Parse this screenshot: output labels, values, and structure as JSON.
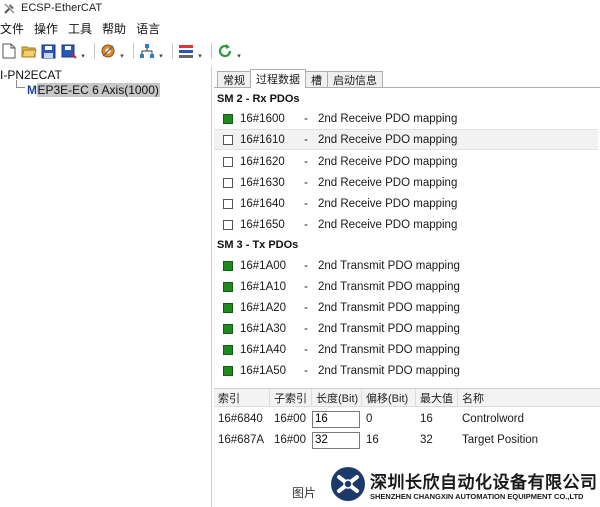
{
  "window": {
    "title": "ECSP-EtherCAT",
    "app_icon": "wrench-screwdriver-icon"
  },
  "menu": [
    "文件",
    "操作",
    "工具",
    "帮助",
    "语言"
  ],
  "toolbar": [
    {
      "icon": "new-file-icon",
      "dropdown": false
    },
    {
      "icon": "open-folder-icon",
      "dropdown": false
    },
    {
      "icon": "save-icon",
      "dropdown": false
    },
    {
      "icon": "save-as-icon",
      "dropdown": true
    },
    {
      "icon": "settings-tool-icon",
      "dropdown": true
    },
    {
      "icon": "network-scan-icon",
      "dropdown": true
    },
    {
      "icon": "device-config-icon",
      "dropdown": true
    },
    {
      "icon": "refresh-icon",
      "dropdown": true
    }
  ],
  "tree": {
    "root": "I-PN2ECAT",
    "child_icon": "M",
    "child": "EP3E-EC 6 Axis(1000)"
  },
  "tabs": [
    {
      "label": "常规",
      "active": false
    },
    {
      "label": "过程数据",
      "active": true
    },
    {
      "label": "槽",
      "active": false
    },
    {
      "label": "启动信息",
      "active": false
    }
  ],
  "rx": {
    "title": "SM 2 - Rx PDOs",
    "items": [
      {
        "index": "16#1600",
        "name": "2nd Receive PDO mapping",
        "checked": true
      },
      {
        "index": "16#1610",
        "name": "2nd Receive PDO mapping",
        "checked": false
      },
      {
        "index": "16#1620",
        "name": "2nd Receive PDO mapping",
        "checked": false
      },
      {
        "index": "16#1630",
        "name": "2nd Receive PDO mapping",
        "checked": false
      },
      {
        "index": "16#1640",
        "name": "2nd Receive PDO mapping",
        "checked": false
      },
      {
        "index": "16#1650",
        "name": "2nd Receive PDO mapping",
        "checked": false
      }
    ]
  },
  "tx": {
    "title": "SM 3 - Tx PDOs",
    "items": [
      {
        "index": "16#1A00",
        "name": "2nd Transmit PDO mapping",
        "checked": true
      },
      {
        "index": "16#1A10",
        "name": "2nd Transmit PDO mapping",
        "checked": true
      },
      {
        "index": "16#1A20",
        "name": "2nd Transmit PDO mapping",
        "checked": true
      },
      {
        "index": "16#1A30",
        "name": "2nd Transmit PDO mapping",
        "checked": true
      },
      {
        "index": "16#1A40",
        "name": "2nd Transmit PDO mapping",
        "checked": true
      },
      {
        "index": "16#1A50",
        "name": "2nd Transmit PDO mapping",
        "checked": true
      }
    ]
  },
  "dash": "-",
  "table": {
    "headers": [
      "索引",
      "子索引",
      "长度(Bit)",
      "偏移(Bit)",
      "最大值",
      "名称"
    ],
    "rows": [
      {
        "index": "16#6840",
        "subindex": "16#00",
        "length": "16",
        "offset": "0",
        "max": "16",
        "name": "Controlword"
      },
      {
        "index": "16#687A",
        "subindex": "16#00",
        "length": "32",
        "offset": "16",
        "max": "32",
        "name": "Target Position"
      }
    ]
  },
  "watermark": {
    "caption": "图片",
    "company_cn": "深圳长欣自动化设备有限公司",
    "company_en": "SHENZHEN CHANGXIN AUTOMATION EQUIPMENT CO.,LTD",
    "logo_color": "#1b3a6b"
  },
  "colors": {
    "checked": "#1f8a1f",
    "selection": "#c7c7c7",
    "tree_icon": "#1f3fa0"
  }
}
